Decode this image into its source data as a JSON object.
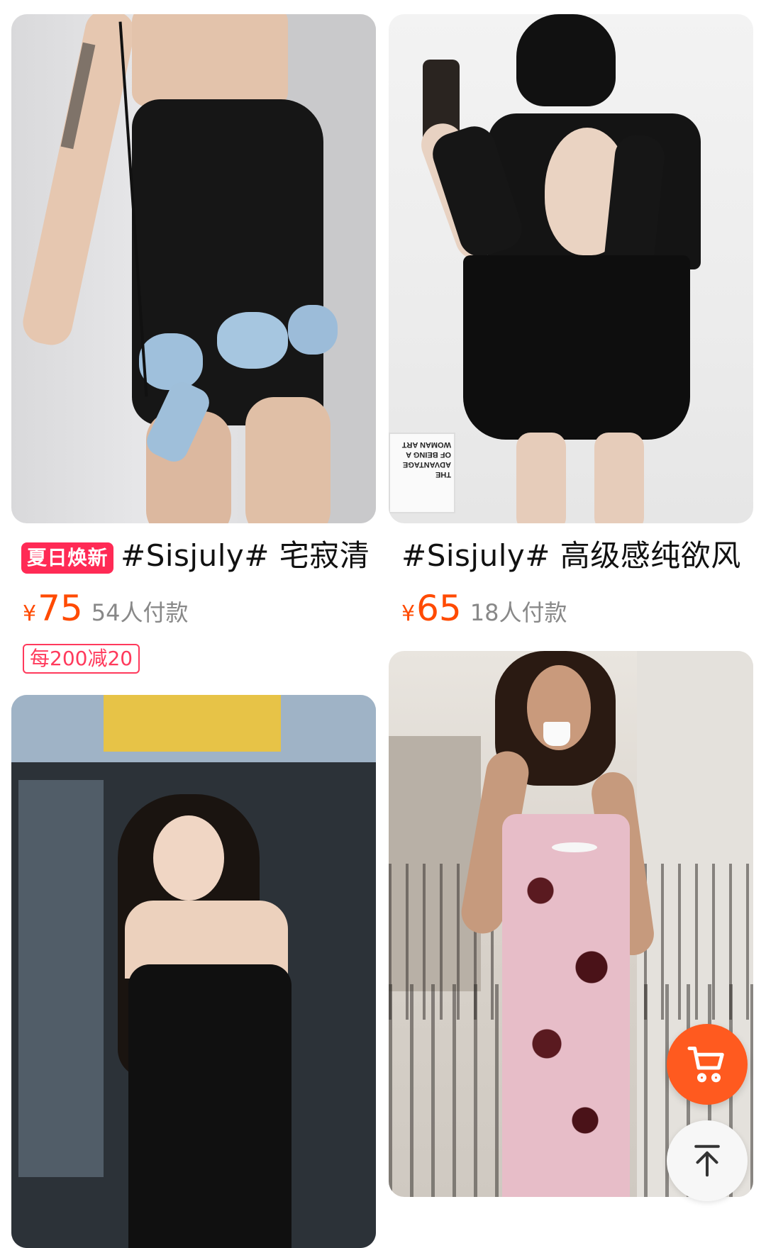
{
  "products": [
    {
      "badge": "夏日焕新",
      "title": "#Sisjuly# 宅寂清",
      "price_symbol": "¥",
      "price": "75",
      "sold": "54人付款",
      "coupon": "每200减20"
    },
    {
      "title": "#Sisjuly# 高级感纯欲风",
      "price_symbol": "¥",
      "price": "65",
      "sold": "18人付款"
    }
  ],
  "poster_text": "THE ADVANTAGE OF BEING A WOMAN ART",
  "icons": {
    "cart": "shopping-cart-icon",
    "top": "arrow-up-icon"
  },
  "colors": {
    "price": "#ff4a00",
    "badge": "#ff2a55",
    "coupon": "#ff3a5c",
    "cart_fab": "#ff5a1f"
  }
}
